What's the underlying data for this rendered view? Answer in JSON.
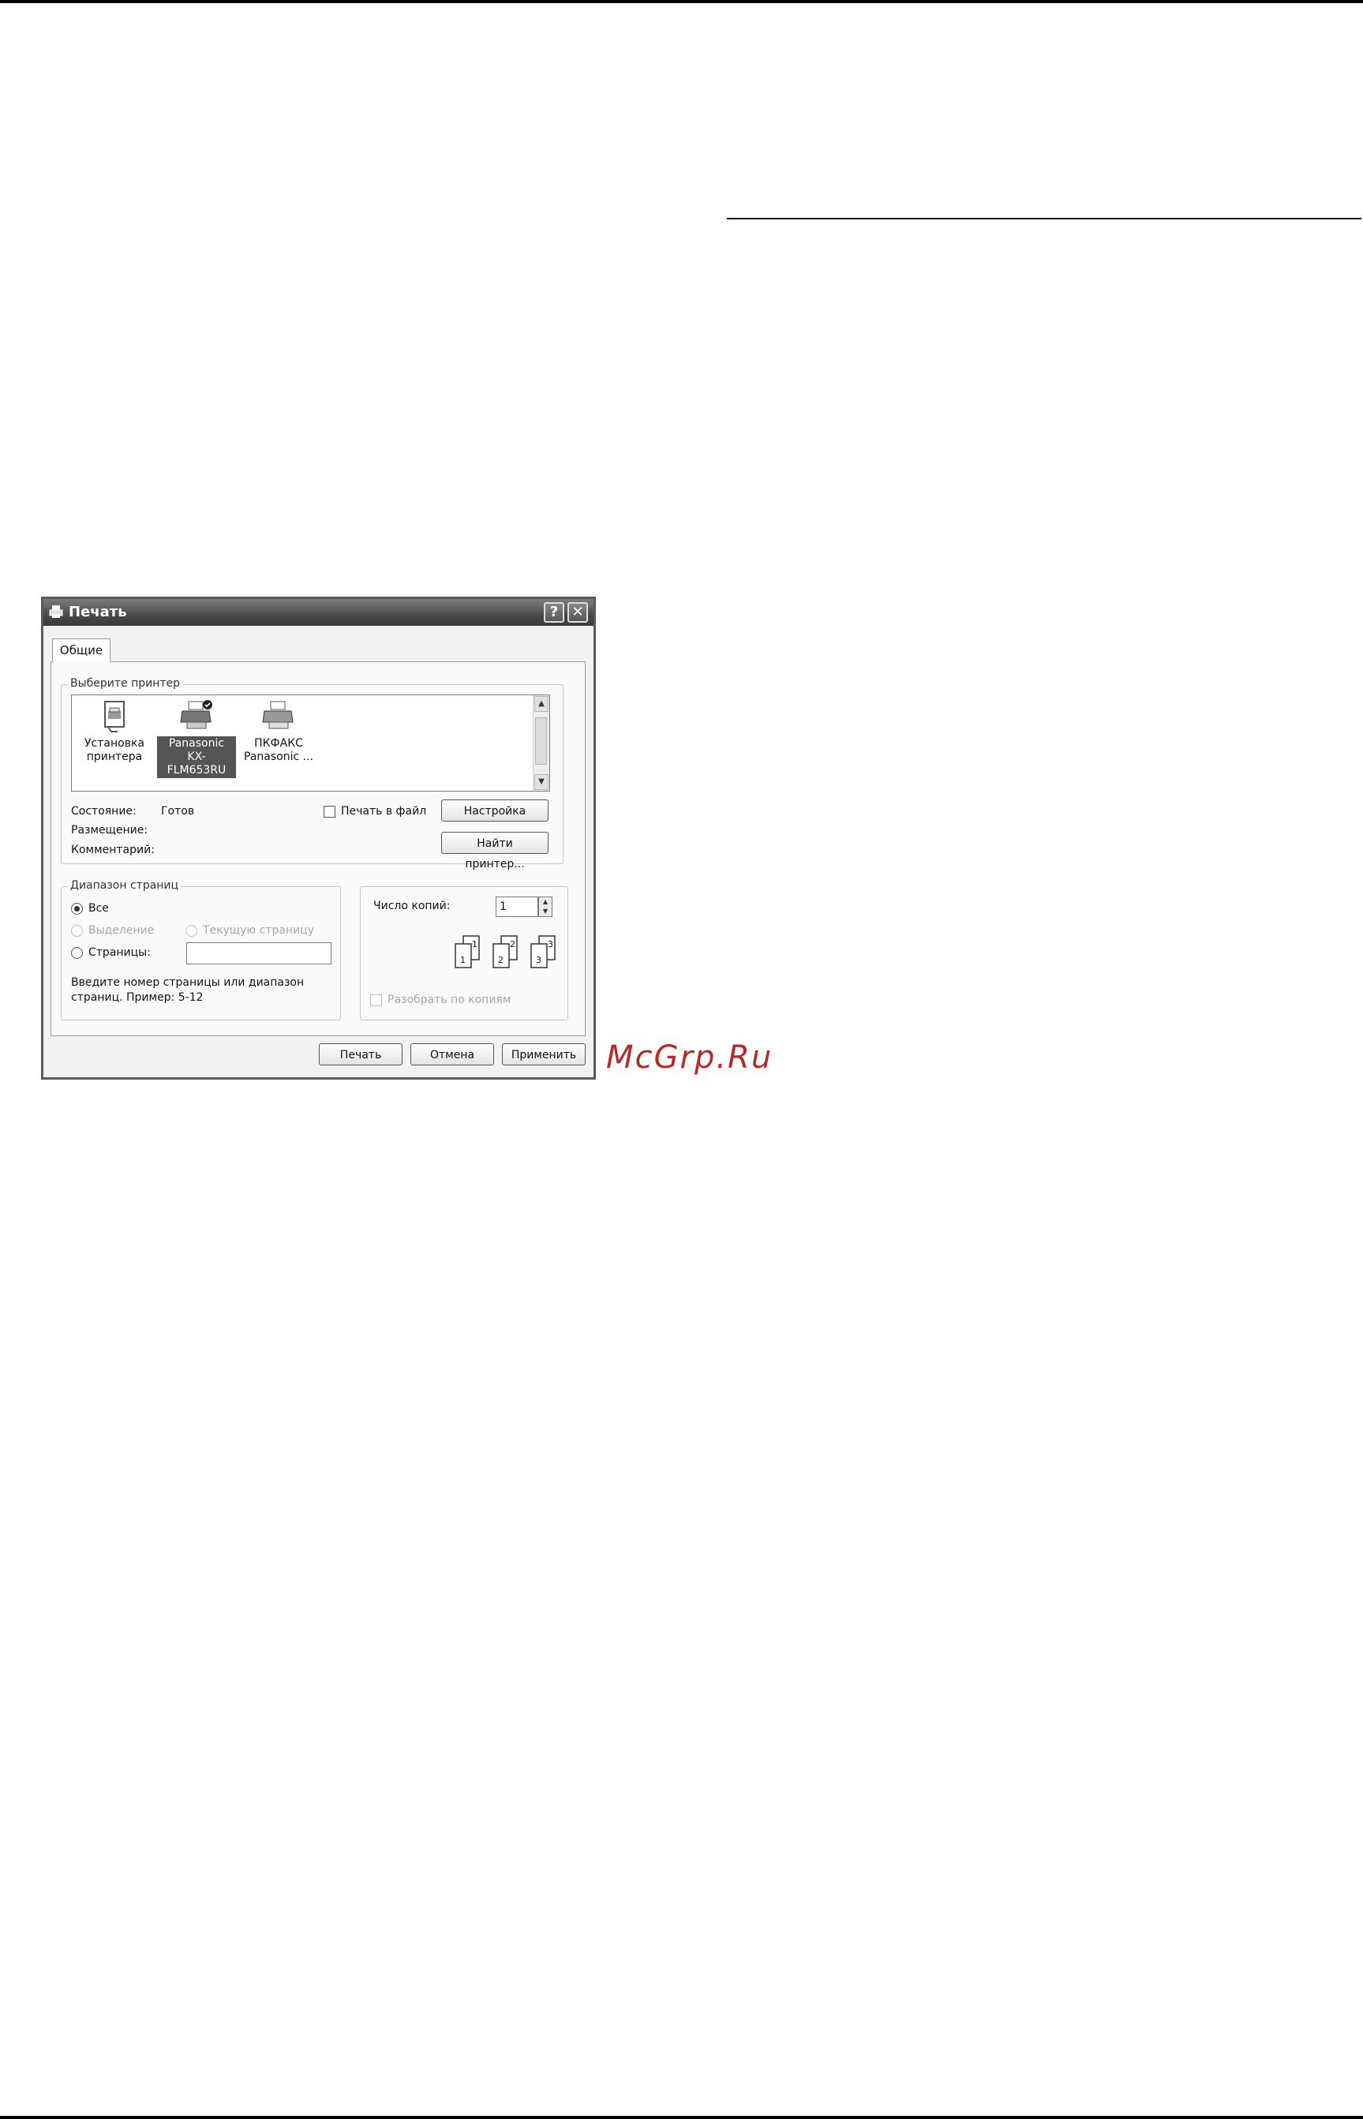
{
  "dialog": {
    "title": "Печать",
    "help_glyph": "?",
    "close_glyph": "✕",
    "tab_label": "Общие"
  },
  "printer_select": {
    "group_label": "Выберите принтер",
    "items": [
      {
        "line1": "Установка",
        "line2": "принтера",
        "icon": "add-printer-icon",
        "selected": false
      },
      {
        "line1": "Panasonic",
        "line2": "KX-FLM653RU",
        "icon": "printer-icon",
        "selected": true
      },
      {
        "line1": "ПКФАКС",
        "line2": "Panasonic ...",
        "icon": "printer-icon",
        "selected": false
      }
    ],
    "status_label": "Состояние:",
    "status_value": "Готов",
    "location_label": "Размещение:",
    "comment_label": "Комментарий:",
    "print_to_file_label": "Печать в файл",
    "preferences_button": "Настройка",
    "find_printer_button": "Найти принтер..."
  },
  "page_range": {
    "group_label": "Диапазон страниц",
    "all_label": "Все",
    "selection_label": "Выделение",
    "current_page_label": "Текущую страницу",
    "pages_label": "Страницы:",
    "pages_value": "",
    "hint": "Введите номер страницы или диапазон страниц.  Пример: 5-12"
  },
  "copies": {
    "count_label": "Число копий:",
    "count_value": "1",
    "collate_label": "Разобрать по копиям",
    "page_numbers": [
      "1",
      "1",
      "2",
      "2",
      "3",
      "3"
    ]
  },
  "footer": {
    "print_button": "Печать",
    "cancel_button": "Отмена",
    "apply_button": "Применить"
  },
  "watermark": "McGrp.Ru",
  "colors": {
    "watermark": "#b32a2a",
    "titlebar": "#4a4a4a",
    "selection": "#555555"
  }
}
